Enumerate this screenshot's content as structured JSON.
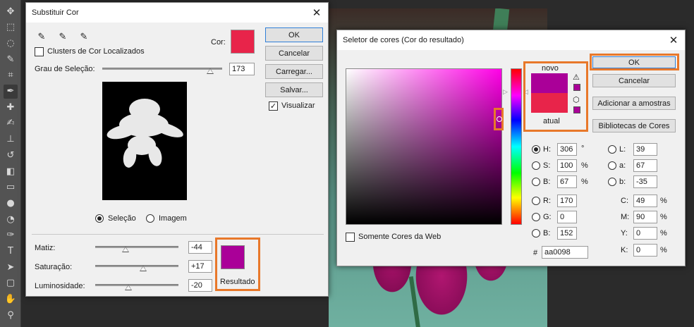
{
  "colors": {
    "cor_swatch": "#e8244a",
    "resultado_swatch": "#aa0098",
    "novo_color": "#aa0098",
    "atual_color": "#e8244a",
    "highlight": "#e8782a"
  },
  "toolbar": {
    "tools": [
      "move-icon",
      "marquee-icon",
      "lasso-icon",
      "quick-select-icon",
      "crop-icon",
      "eyedropper-icon",
      "healing-icon",
      "brush-icon",
      "stamp-icon",
      "history-brush-icon",
      "eraser-icon",
      "gradient-icon",
      "blur-icon",
      "dodge-icon",
      "pen-icon",
      "type-icon",
      "path-select-icon",
      "rectangle-icon",
      "hand-icon",
      "zoom-icon"
    ]
  },
  "replace_dialog": {
    "title": "Substituir Cor",
    "close": "✕",
    "clusters_label": "Clusters de Cor Localizados",
    "cor_label": "Cor:",
    "grau_label": "Grau de Seleção:",
    "grau_value": "173",
    "grau_level": 0.9,
    "ok": "OK",
    "cancel": "Cancelar",
    "load": "Carregar...",
    "save": "Salvar...",
    "preview_label": "Visualizar",
    "preview_checked": "✓",
    "selecao_label": "Seleção",
    "imagem_label": "Imagem",
    "matiz_label": "Matiz:",
    "matiz_value": "-44",
    "saturacao_label": "Saturação:",
    "saturacao_value": "+17",
    "luminosidade_label": "Luminosidade:",
    "luminosidade_value": "-20",
    "resultado_label": "Resultado"
  },
  "picker_dialog": {
    "title": "Seletor de cores (Cor do resultado)",
    "close": "✕",
    "novo_label": "novo",
    "atual_label": "atual",
    "ok": "OK",
    "cancel": "Cancelar",
    "add_swatches": "Adicionar a amostras",
    "libraries": "Bibliotecas de Cores",
    "web_only": "Somente Cores da Web",
    "h_label": "H:",
    "h_value": "306",
    "h_unit": "°",
    "s_label": "S:",
    "s_value": "100",
    "s_unit": "%",
    "b_label": "B:",
    "b_value": "67",
    "b_unit": "%",
    "r_label": "R:",
    "r_value": "170",
    "g_label": "G:",
    "g_value": "0",
    "bb_label": "B:",
    "bb_value": "152",
    "l_label": "L:",
    "l_value": "39",
    "a_label": "a:",
    "a_value": "67",
    "lb_label": "b:",
    "lb_value": "-35",
    "c_label": "C:",
    "c_value": "49",
    "c_unit": "%",
    "m_label": "M:",
    "m_value": "90",
    "m_unit": "%",
    "y_label": "Y:",
    "y_value": "0",
    "y_unit": "%",
    "k_label": "K:",
    "k_value": "0",
    "k_unit": "%",
    "hex_label": "#",
    "hex_value": "aa0098"
  }
}
